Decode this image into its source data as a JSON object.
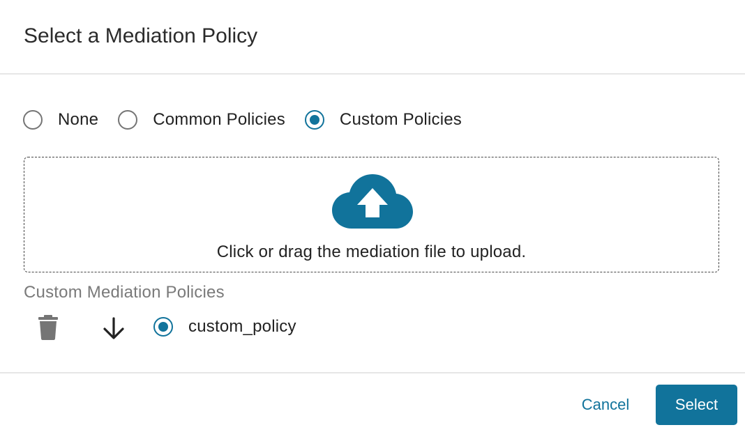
{
  "dialog": {
    "title": "Select a Mediation Policy"
  },
  "policy_type": {
    "options": [
      {
        "label": "None",
        "checked": false
      },
      {
        "label": "Common Policies",
        "checked": false
      },
      {
        "label": "Custom Policies",
        "checked": true
      }
    ]
  },
  "upload": {
    "icon": "cloud-upload-icon",
    "text": "Click or drag the mediation file to upload."
  },
  "custom_policies": {
    "section_label": "Custom Mediation Policies",
    "items": [
      {
        "name": "custom_policy",
        "checked": true,
        "delete_icon": "trash-icon",
        "download_icon": "arrow-down-icon"
      }
    ]
  },
  "footer": {
    "cancel_label": "Cancel",
    "select_label": "Select"
  },
  "colors": {
    "accent": "#11739b",
    "radio_unchecked": "#757575",
    "muted_text": "#7a7a7a",
    "divider": "#e6e6e6",
    "icon_gray": "#757575"
  }
}
